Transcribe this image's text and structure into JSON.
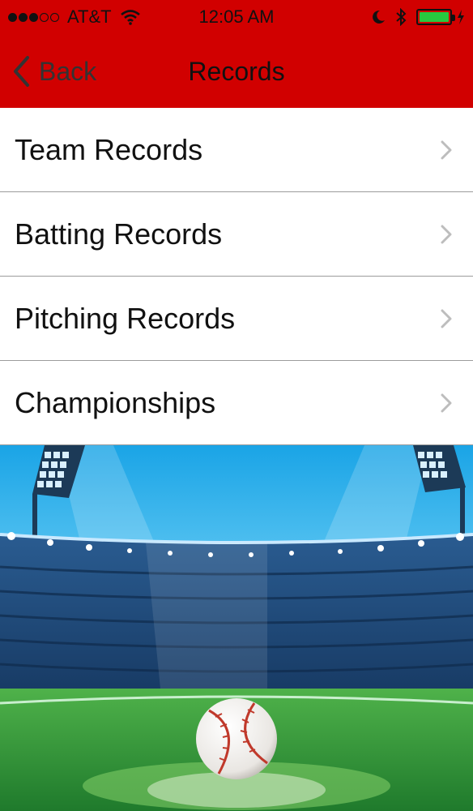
{
  "status_bar": {
    "carrier": "AT&T",
    "time": "12:05 AM",
    "signal_bars": 3,
    "battery_level": 1
  },
  "nav": {
    "back_label": "Back",
    "title": "Records"
  },
  "list": {
    "items": [
      {
        "label": "Team Records"
      },
      {
        "label": "Batting Records"
      },
      {
        "label": "Pitching Records"
      },
      {
        "label": "Championships"
      }
    ]
  },
  "colors": {
    "nav_bar": "#d10000",
    "battery_fill": "#27c93f",
    "chevron": "#bdbdbd"
  },
  "icons": [
    "signal-dots-icon",
    "wifi-icon",
    "moon-icon",
    "bluetooth-icon",
    "battery-icon",
    "back-chevron-icon",
    "chevron-right-icon"
  ],
  "illustration": "baseball-stadium-illustration"
}
